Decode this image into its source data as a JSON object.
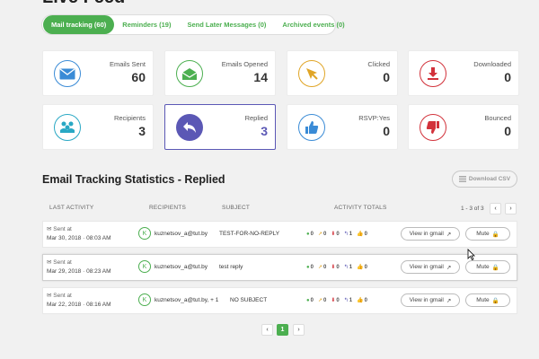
{
  "page_title": "Live Feed",
  "tabs": [
    {
      "label": "Mail tracking (60)",
      "active": true
    },
    {
      "label": "Reminders (19)",
      "active": false
    },
    {
      "label": "Send Later Messages (0)",
      "active": false
    },
    {
      "label": "Archived events (0)",
      "active": false
    }
  ],
  "cards": [
    {
      "label": "Emails Sent",
      "value": "60"
    },
    {
      "label": "Emails Opened",
      "value": "14"
    },
    {
      "label": "Clicked",
      "value": "0"
    },
    {
      "label": "Downloaded",
      "value": "0"
    },
    {
      "label": "Recipients",
      "value": "3"
    },
    {
      "label": "Replied",
      "value": "3"
    },
    {
      "label": "RSVP:Yes",
      "value": "0"
    },
    {
      "label": "Bounced",
      "value": "0"
    }
  ],
  "section_title": "Email Tracking Statistics - Replied",
  "download_label": "Download CSV",
  "table": {
    "headers": {
      "last_activity": "LAST ACTIVITY",
      "recipients": "RECIPIENTS",
      "subject": "SUBJECT",
      "activity_totals": "ACTIVITY TOTALS"
    },
    "pager_info": "1 - 3 of 3",
    "rows": [
      {
        "sent_label": "Sent at",
        "date": "Mar 30, 2018 · 08:03 AM",
        "avatar": "K",
        "recipient": "kuznetsov_a@tut.by",
        "subject": "TEST-FOR-NO-REPLY",
        "opens": "0",
        "clicks": "0",
        "downloads": "0",
        "replies": "1",
        "likes": "0",
        "gmail_label": "View in gmail",
        "mute_label": "Mute"
      },
      {
        "sent_label": "Sent at",
        "date": "Mar 29, 2018 · 08:23 AM",
        "avatar": "K",
        "recipient": "kuznetsov_a@tut.by",
        "subject": "test reply",
        "opens": "0",
        "clicks": "0",
        "downloads": "0",
        "replies": "1",
        "likes": "0",
        "gmail_label": "View in gmail",
        "mute_label": "Mute"
      },
      {
        "sent_label": "Sent at",
        "date": "Mar 22, 2018 · 08:16 AM",
        "avatar": "K",
        "recipient": "kuznetsov_a@tut.by, + 1",
        "subject": "NO SUBJECT",
        "opens": "0",
        "clicks": "0",
        "downloads": "0",
        "replies": "1",
        "likes": "0",
        "gmail_label": "View in gmail",
        "mute_label": "Mute"
      }
    ]
  },
  "bottom_pager": {
    "current": "1"
  },
  "colors": {
    "accent": "#4caf50",
    "selected": "#5b58b5"
  }
}
